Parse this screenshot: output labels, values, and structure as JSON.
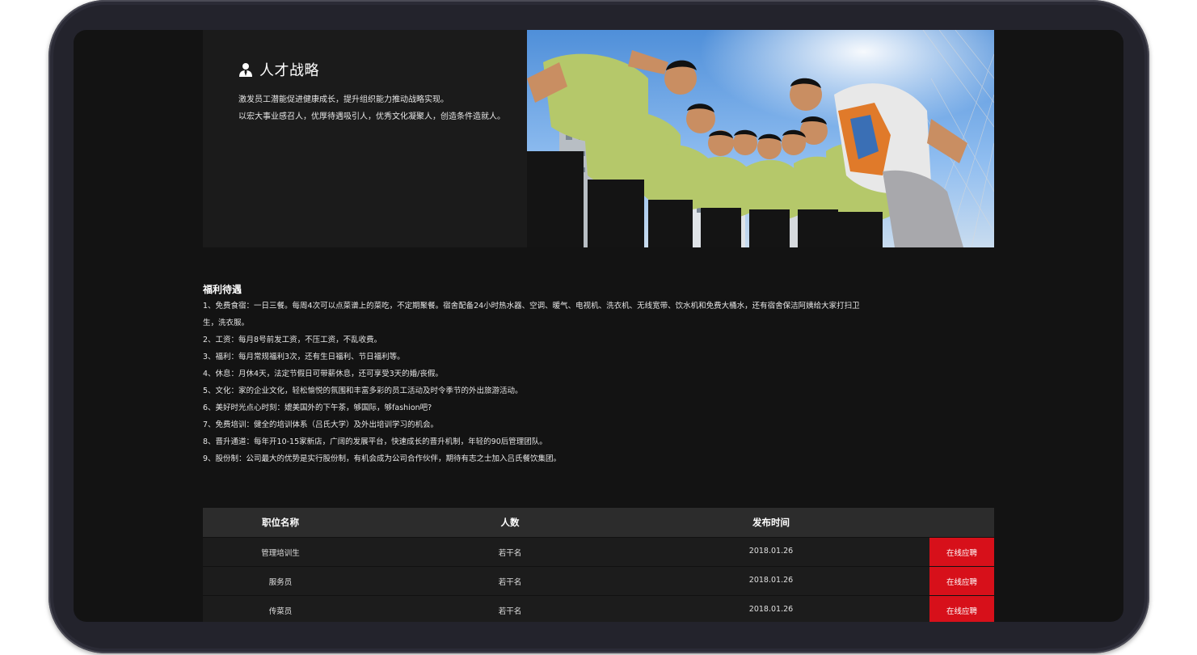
{
  "hero": {
    "title": "人才战略",
    "icon": "person-suit-icon",
    "lines": [
      "激发员工潜能促进健康成长，提升组织能力推动战略实现。",
      "以宏大事业感召人，优厚待遇吸引人，优秀文化凝聚人，创造条件造就人。"
    ]
  },
  "benefits": {
    "title": "福利待遇",
    "items": [
      "1、免费食宿：一日三餐。每周4次可以点菜谱上的菜吃，不定期聚餐。宿舍配备24小时热水器、空调、暖气、电视机、洗衣机、无线宽带、饮水机和免费大桶水，还有宿舍保洁阿姨给大家打扫卫",
      "生，洗衣服。",
      "2、工资：每月8号前发工资，不压工资，不乱收费。",
      "3、福利：每月常规福利3次，还有生日福利、节日福利等。",
      "4、休息：月休4天，法定节假日可带薪休息，还可享受3天的婚/丧假。",
      "5、文化：家的企业文化，轻松愉悦的氛围和丰富多彩的员工活动及时令季节的外出旅游活动。",
      "6、美好时光点心时刻：媲美国外的下午茶，够国际，够fashion吧?",
      "7、免费培训：健全的培训体系（吕氏大学）及外出培训学习的机会。",
      "8、晋升通道：每年开10-15家新店，广阔的发展平台，快速成长的晋升机制，年轻的90后管理团队。",
      "9、股份制：公司最大的优势是实行股份制，有机会成为公司合作伙伴，期待有志之士加入吕氏餐饮集团。"
    ]
  },
  "jobs": {
    "headers": [
      "职位名称",
      "人数",
      "发布时间"
    ],
    "rows": [
      {
        "position": "管理培训生",
        "count": "若干名",
        "date": "2018.01.26",
        "apply": "在线应聘"
      },
      {
        "position": "服务员",
        "count": "若干名",
        "date": "2018.01.26",
        "apply": "在线应聘"
      },
      {
        "position": "传菜员",
        "count": "若干名",
        "date": "2018.01.26",
        "apply": "在线应聘"
      }
    ]
  },
  "colors": {
    "screen_bg": "#131313",
    "panel_bg": "#1b1b1b",
    "table_head_bg": "#2c2c2c",
    "apply_red": "#d7101a"
  }
}
